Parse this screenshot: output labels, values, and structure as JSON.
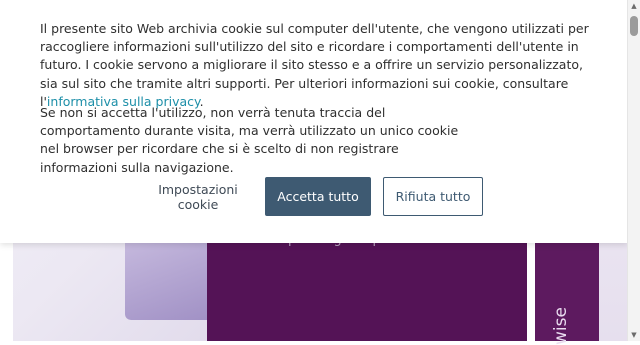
{
  "hero": {
    "panel_text": "utilizzata per diagnosi precise e sicure.",
    "side_text": "wise"
  },
  "cookie_banner": {
    "paragraph1_before_link": "Il presente sito Web archivia cookie sul computer dell'utente, che vengono utilizzati per raccogliere informazioni sull'utilizzo del sito e ricordare i comportamenti dell'utente in futuro. I cookie servono a migliorare il sito stesso e a offrire un servizio personalizzato, sia sul sito che tramite altri supporti. Per ulteriori informazioni sui cookie, consultare l'",
    "privacy_link": "informativa sulla privacy",
    "paragraph1_after_link": ".",
    "paragraph2": "Se non si accetta l'utilizzo, non verrà tenuta traccia del comportamento durante visita, ma verrà utilizzato un unico cookie nel browser per ricordare che si è scelto di non registrare informazioni sulla navigazione.",
    "buttons": {
      "settings": "Impostazioni cookie",
      "accept": "Accetta tutto",
      "reject": "Rifiuta tutto"
    }
  },
  "scrollbar": {
    "up_icon": "▲",
    "down_icon": "▼"
  },
  "colors": {
    "accent": "#3e5a72",
    "link": "#1d8fa8",
    "hero_purple": "#541356"
  }
}
